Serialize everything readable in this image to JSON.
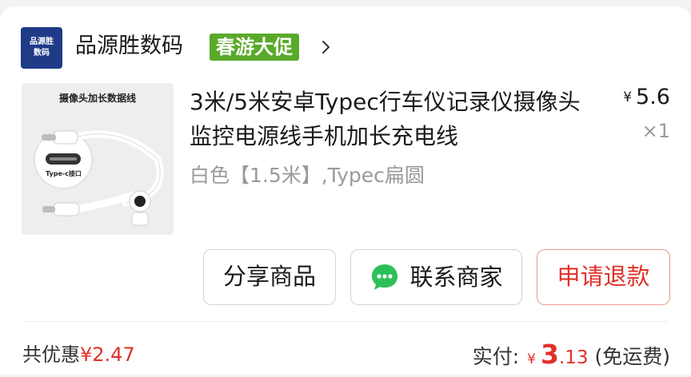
{
  "store": {
    "logo_line1": "品源胜",
    "logo_line2": "数码",
    "name": "品源胜数码",
    "promo_badge": "春游大促"
  },
  "product": {
    "thumb_title": "摄像头加长数据线",
    "thumb_label": "Type-c接口",
    "title": "3米/5米安卓Typec行车仪记录仪摄像头监控电源线手机加长充电线",
    "spec": "白色【1.5米】,Typec扁圆",
    "price_currency": "¥",
    "price": "5.6",
    "quantity": "×1"
  },
  "actions": {
    "share_label": "分享商品",
    "contact_label": "联系商家",
    "refund_label": "申请退款"
  },
  "summary": {
    "discount_label": "共优惠",
    "discount_value": "¥2.47",
    "paid_label": "实付:",
    "paid_currency": "¥",
    "paid_int": "3",
    "paid_dec": ".13",
    "shipping_note": "(免运费)"
  },
  "colors": {
    "store_logo_bg": "#1f3b88",
    "promo_green": "#5aa92a",
    "accent_red": "#e0312a",
    "chat_green": "#2cc05a"
  }
}
